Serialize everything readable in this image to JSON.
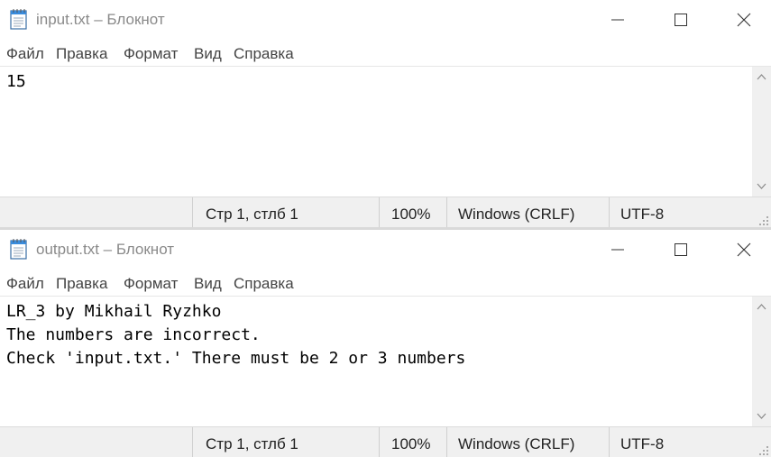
{
  "windows": [
    {
      "title": "input.txt – Блокнот",
      "menu": [
        "Файл",
        "Правка",
        "Формат",
        "Вид",
        "Справка"
      ],
      "content": "15",
      "status": {
        "position": "Стр 1, стлб 1",
        "zoom": "100%",
        "line_ending": "Windows (CRLF)",
        "encoding": "UTF-8"
      },
      "controls": {
        "minimize_icon": "minimize-icon",
        "maximize_icon": "maximize-icon",
        "close_icon": "close-icon"
      }
    },
    {
      "title": "output.txt – Блокнот",
      "menu": [
        "Файл",
        "Правка",
        "Формат",
        "Вид",
        "Справка"
      ],
      "content": "LR_3 by Mikhail Ryzhko\nThe numbers are incorrect.\nCheck 'input.txt.' There must be 2 or 3 numbers",
      "status": {
        "position": "Стр 1, стлб 1",
        "zoom": "100%",
        "line_ending": "Windows (CRLF)",
        "encoding": "UTF-8"
      },
      "controls": {
        "minimize_icon": "minimize-icon",
        "maximize_icon": "maximize-icon",
        "close_icon": "close-icon"
      }
    }
  ],
  "colors": {
    "title_text": "#8a8a8a",
    "statusbar_bg": "#f0f0f0",
    "editor_bg": "#ffffff"
  }
}
